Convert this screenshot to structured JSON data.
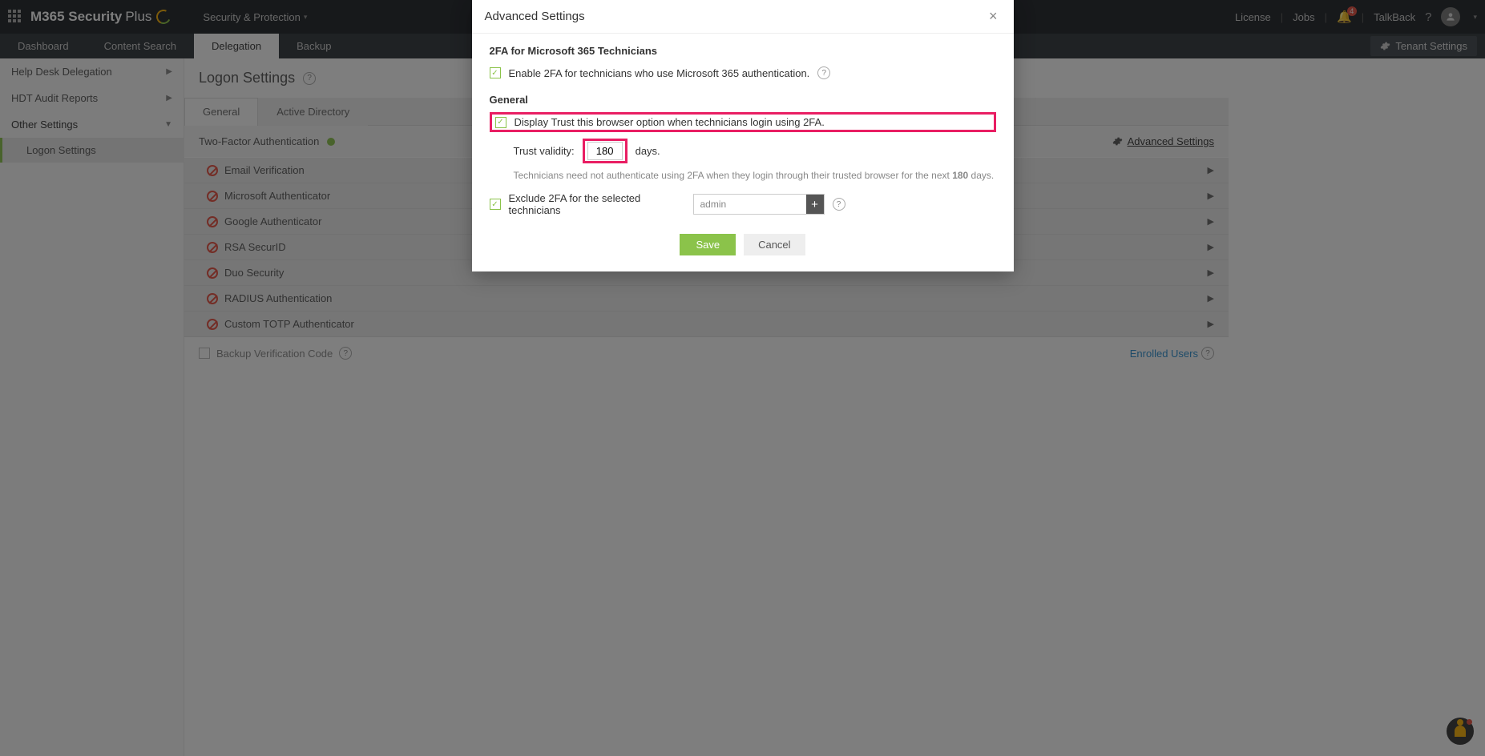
{
  "topbar": {
    "brand": "M365 Security",
    "brand_suffix": "Plus",
    "dropdown": "Security & Protection",
    "license": "License",
    "jobs": "Jobs",
    "notif_count": "4",
    "talkback": "TalkBack"
  },
  "subnav": {
    "tabs": [
      "Dashboard",
      "Content Search",
      "Delegation",
      "Backup"
    ],
    "tenant_btn": "Tenant Settings"
  },
  "sidebar": {
    "items": [
      {
        "label": "Help Desk Delegation",
        "expandable": true
      },
      {
        "label": "HDT Audit Reports",
        "expandable": true
      },
      {
        "label": "Other Settings",
        "expanded": true
      }
    ],
    "subitem": "Logon Settings"
  },
  "page": {
    "title": "Logon Settings",
    "tabs": [
      "General",
      "Active Directory"
    ],
    "tfa_label": "Two-Factor Authentication",
    "adv_link": "Advanced Settings",
    "methods": [
      "Email Verification",
      "Microsoft Authenticator",
      "Google Authenticator",
      "RSA SecurID",
      "Duo Security",
      "RADIUS Authentication",
      "Custom TOTP Authenticator"
    ],
    "backup_label": "Backup Verification Code",
    "enrolled_label": "Enrolled Users"
  },
  "modal": {
    "title": "Advanced Settings",
    "section1": "2FA for Microsoft 365 Technicians",
    "enable_2fa": "Enable 2FA for technicians who use Microsoft 365 authentication.",
    "section2": "General",
    "trust_browser": "Display Trust this browser option when technicians login using 2FA.",
    "trust_validity_label": "Trust validity:",
    "trust_days_value": "180",
    "trust_days_suffix": "days.",
    "hint_pre": "Technicians need not authenticate using 2FA when they login through their trusted browser for the next ",
    "hint_bold": "180",
    "hint_post": " days.",
    "exclude_label": "Exclude 2FA for the selected technicians",
    "exclude_value": "admin",
    "save": "Save",
    "cancel": "Cancel"
  }
}
